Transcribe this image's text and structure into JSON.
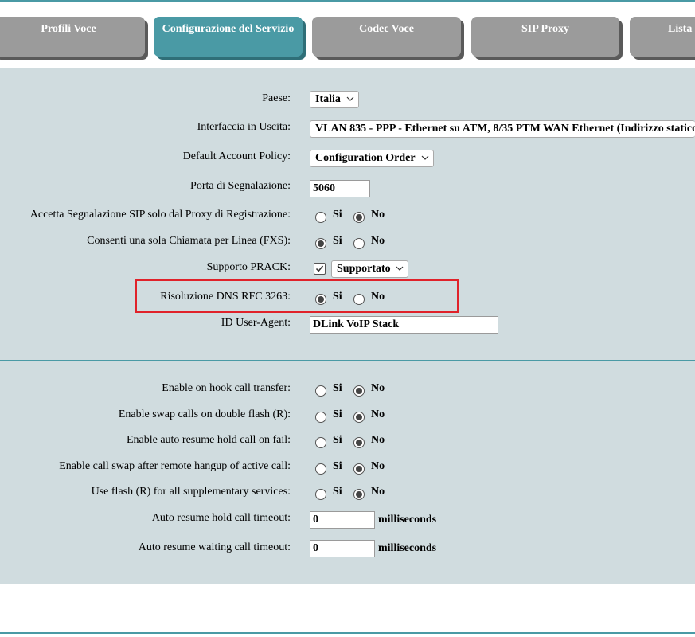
{
  "tabs": [
    {
      "label": "Profili Voce",
      "active": false
    },
    {
      "label": "Configurazione del Servizio",
      "active": true
    },
    {
      "label": "Codec Voce",
      "active": false
    },
    {
      "label": "SIP Proxy",
      "active": false
    },
    {
      "label": "Lista",
      "active": false
    }
  ],
  "form": {
    "paese": {
      "label": "Paese:",
      "value": "Italia"
    },
    "interfaccia": {
      "label": "Interfaccia in Uscita:",
      "value": "VLAN 835 - PPP - Ethernet su ATM, 8/35 PTM WAN Ethernet (Indirizzo statico"
    },
    "account_policy": {
      "label": "Default Account Policy:",
      "value": "Configuration Order"
    },
    "porta": {
      "label": "Porta di Segnalazione:",
      "value": "5060"
    },
    "accetta_sip": {
      "label": "Accetta Segnalazione SIP solo dal Proxy di Registrazione:",
      "yes": "Si",
      "no": "No",
      "selected": "no"
    },
    "sola_chiamata": {
      "label": "Consenti una sola Chiamata per Linea (FXS):",
      "yes": "Si",
      "no": "No",
      "selected": "yes"
    },
    "prack": {
      "label": "Supporto PRACK:",
      "checked": true,
      "value": "Supportato"
    },
    "dns": {
      "label": "Risoluzione DNS RFC 3263:",
      "yes": "Si",
      "no": "No",
      "selected": "yes"
    },
    "user_agent": {
      "label": "ID User-Agent:",
      "value": "DLink VoIP Stack"
    }
  },
  "calls": {
    "hook_transfer": {
      "label": "Enable on hook call transfer:",
      "yes": "Si",
      "no": "No",
      "selected": "no"
    },
    "swap_flash": {
      "label": "Enable swap calls on double flash (R):",
      "yes": "Si",
      "no": "No",
      "selected": "no"
    },
    "auto_resume": {
      "label": "Enable auto resume hold call on fail:",
      "yes": "Si",
      "no": "No",
      "selected": "no"
    },
    "call_swap": {
      "label": "Enable call swap after remote hangup of active call:",
      "yes": "Si",
      "no": "No",
      "selected": "no"
    },
    "flash_all": {
      "label": "Use flash (R) for all supplementary services:",
      "yes": "Si",
      "no": "No",
      "selected": "no"
    },
    "hold_timeout": {
      "label": "Auto resume hold call timeout:",
      "value": "0",
      "unit": "milliseconds"
    },
    "waiting_timeout": {
      "label": "Auto resume waiting call timeout:",
      "value": "0",
      "unit": "milliseconds"
    }
  },
  "colors": {
    "accent": "#4a9aa5",
    "tab_inactive": "#9b9b9b",
    "panel": "#d0dcdf",
    "highlight": "#e0222a"
  }
}
